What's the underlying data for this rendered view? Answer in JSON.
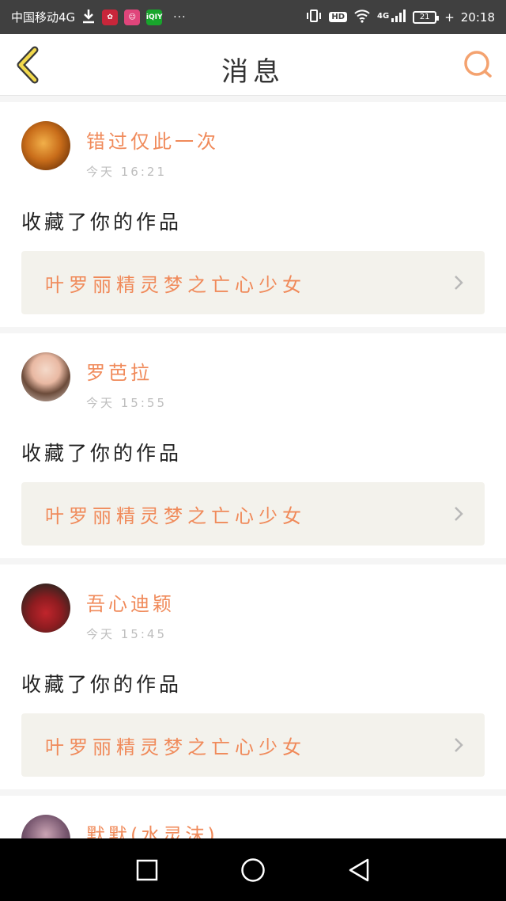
{
  "status_bar": {
    "carrier": "中国移动4G",
    "app_icons": [
      "huawei-icon",
      "game-icon",
      "iqiyi-icon"
    ],
    "iqiyi_label": "iQIY",
    "more": "···",
    "hd_badge": "HD",
    "network": "4G",
    "battery_level": "21",
    "time": "20:18"
  },
  "navbar": {
    "title": "消息"
  },
  "messages": [
    {
      "username": "错过仅此一次",
      "time": "今天 16:21",
      "action": "收藏了你的作品",
      "work_title": "叶罗丽精灵梦之亡心少女"
    },
    {
      "username": "罗芭拉",
      "time": "今天 15:55",
      "action": "收藏了你的作品",
      "work_title": "叶罗丽精灵梦之亡心少女"
    },
    {
      "username": "吾心迪颖",
      "time": "今天 15:45",
      "action": "收藏了你的作品",
      "work_title": "叶罗丽精灵梦之亡心少女"
    },
    {
      "username": "默默(水灵沫)"
    }
  ],
  "colors": {
    "accent": "#f08a5a",
    "status_bar_bg": "#404040",
    "work_card_bg": "#f3f2ec",
    "feed_bg": "#f5f5f5"
  }
}
